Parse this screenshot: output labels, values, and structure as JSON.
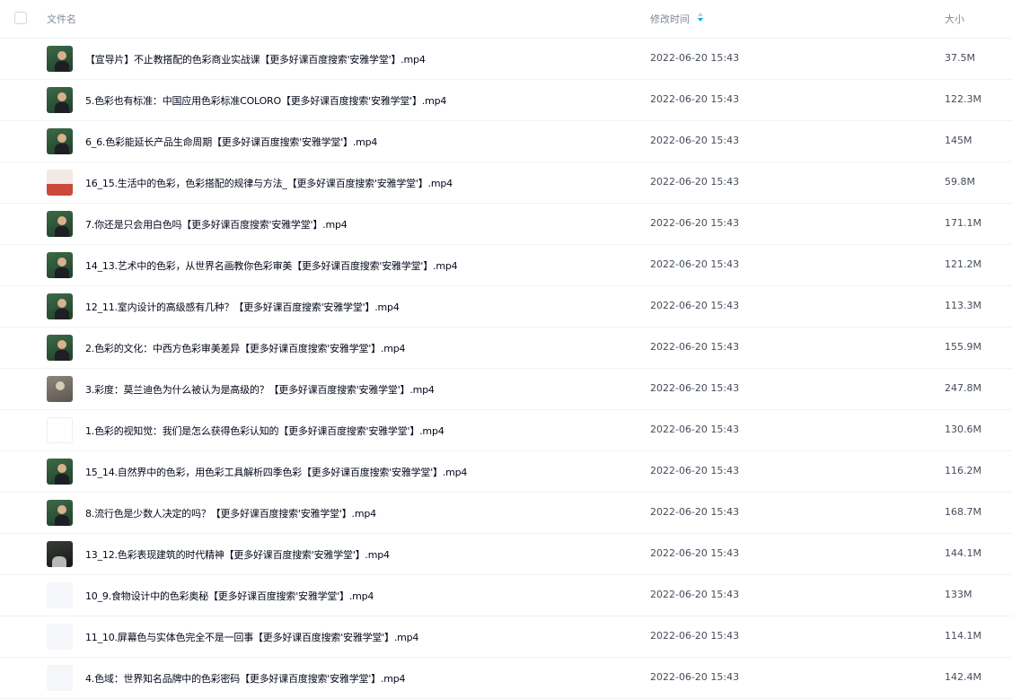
{
  "header": {
    "name_label": "文件名",
    "time_label": "修改时间",
    "size_label": "大小",
    "sort_icon": "sort-icon"
  },
  "files": [
    {
      "name": "【宣导片】不止教搭配的色彩商业实战课【更多好课百度搜索'安雅学堂'】.mp4",
      "time": "2022-06-20 15:43",
      "size": "37.5M",
      "thumb": "green"
    },
    {
      "name": "5.色彩也有标准：中国应用色彩标准COLORO【更多好课百度搜索'安雅学堂'】.mp4",
      "time": "2022-06-20 15:43",
      "size": "122.3M",
      "thumb": "green"
    },
    {
      "name": "6_6.色彩能延长产品生命周期【更多好课百度搜索'安雅学堂'】.mp4",
      "time": "2022-06-20 15:43",
      "size": "145M",
      "thumb": "green"
    },
    {
      "name": "16_15.生活中的色彩，色彩搭配的规律与方法_【更多好课百度搜索'安雅学堂'】.mp4",
      "time": "2022-06-20 15:43",
      "size": "59.8M",
      "thumb": "red"
    },
    {
      "name": "7.你还是只会用白色吗【更多好课百度搜索'安雅学堂'】.mp4",
      "time": "2022-06-20 15:43",
      "size": "171.1M",
      "thumb": "green"
    },
    {
      "name": "14_13.艺术中的色彩，从世界名画教你色彩审美【更多好课百度搜索'安雅学堂'】.mp4",
      "time": "2022-06-20 15:43",
      "size": "121.2M",
      "thumb": "green"
    },
    {
      "name": "12_11.室内设计的高级感有几种？【更多好课百度搜索'安雅学堂'】.mp4",
      "time": "2022-06-20 15:43",
      "size": "113.3M",
      "thumb": "green"
    },
    {
      "name": "2.色彩的文化：中西方色彩审美差异【更多好课百度搜索'安雅学堂'】.mp4",
      "time": "2022-06-20 15:43",
      "size": "155.9M",
      "thumb": "green"
    },
    {
      "name": "3.彩度：莫兰迪色为什么被认为是高级的？【更多好课百度搜索'安雅学堂'】.mp4",
      "time": "2022-06-20 15:43",
      "size": "247.8M",
      "thumb": "painting"
    },
    {
      "name": "1.色彩的视知觉：我们是怎么获得色彩认知的【更多好课百度搜索'安雅学堂'】.mp4",
      "time": "2022-06-20 15:43",
      "size": "130.6M",
      "thumb": "sketch"
    },
    {
      "name": "15_14.自然界中的色彩，用色彩工具解析四季色彩【更多好课百度搜索'安雅学堂'】.mp4",
      "time": "2022-06-20 15:43",
      "size": "116.2M",
      "thumb": "green"
    },
    {
      "name": "8.流行色是少数人决定的吗？【更多好课百度搜索'安雅学堂'】.mp4",
      "time": "2022-06-20 15:43",
      "size": "168.7M",
      "thumb": "green"
    },
    {
      "name": "13_12.色彩表现建筑的时代精神【更多好课百度搜索'安雅学堂'】.mp4",
      "time": "2022-06-20 15:43",
      "size": "144.1M",
      "thumb": "dark"
    },
    {
      "name": "10_9.食物设计中的色彩奥秘【更多好课百度搜索'安雅学堂'】.mp4",
      "time": "2022-06-20 15:43",
      "size": "133M",
      "thumb": "blank"
    },
    {
      "name": "11_10.屏幕色与实体色完全不是一回事【更多好课百度搜索'安雅学堂'】.mp4",
      "time": "2022-06-20 15:43",
      "size": "114.1M",
      "thumb": "blank"
    },
    {
      "name": "4.色域：世界知名品牌中的色彩密码【更多好课百度搜索'安雅学堂'】.mp4",
      "time": "2022-06-20 15:43",
      "size": "142.4M",
      "thumb": "blank"
    }
  ],
  "colors": {
    "accent": "#06a7ff",
    "thumb_green": "#2e5b3a",
    "thumb_red": "#c94a3a"
  }
}
